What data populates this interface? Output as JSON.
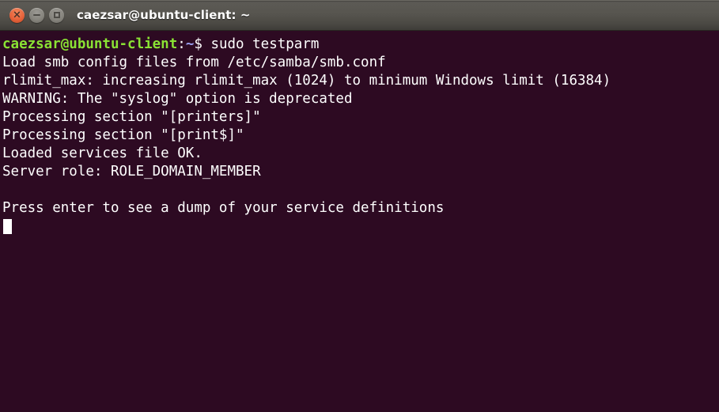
{
  "window": {
    "title": "caezsar@ubuntu-client: ~",
    "controls": {
      "close_label": "×",
      "minimize_label": "−",
      "maximize_label": "□"
    }
  },
  "colors": {
    "terminal_background": "#2d0a22",
    "prompt_green": "#8ae234",
    "text_white": "#ffffff",
    "path_blue": "#9a9ef0",
    "titlebar_gray": "#57554f",
    "close_button_orange": "#e8643c"
  },
  "terminal": {
    "prompt": {
      "user_host": "caezsar@ubuntu-client",
      "separator": ":",
      "path": "~",
      "sigil": "$",
      "command": " sudo testparm"
    },
    "output_lines": [
      "Load smb config files from /etc/samba/smb.conf",
      "rlimit_max: increasing rlimit_max (1024) to minimum Windows limit (16384)",
      "WARNING: The \"syslog\" option is deprecated",
      "Processing section \"[printers]\"",
      "Processing section \"[print$]\"",
      "Loaded services file OK.",
      "Server role: ROLE_DOMAIN_MEMBER",
      "",
      "Press enter to see a dump of your service definitions"
    ]
  }
}
